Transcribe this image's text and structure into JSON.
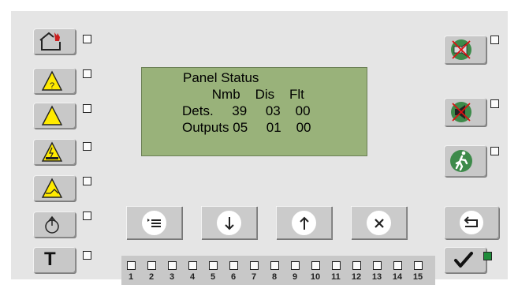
{
  "display": {
    "title": "Panel Status",
    "header_row": "        Nmb    Dis    Flt",
    "dets_row": "Dets.     39     03    00",
    "outputs_row": "Outputs 05     01    00"
  },
  "left_buttons": [
    {
      "icon": "house-fire-icon",
      "led": "off"
    },
    {
      "icon": "warning-question-icon",
      "led": "off"
    },
    {
      "icon": "warning-triangle-icon",
      "led": "off"
    },
    {
      "icon": "electrical-fault-icon",
      "led": "off"
    },
    {
      "icon": "test-triangle-icon",
      "led": "off"
    },
    {
      "icon": "power-icon",
      "led": "off"
    },
    {
      "icon": "test-t-icon",
      "label": "T",
      "led": "off"
    }
  ],
  "right_buttons": [
    {
      "icon": "buzzer-mute-icon",
      "led": "off"
    },
    {
      "icon": "sounder-silence-icon",
      "led": "off"
    },
    {
      "icon": "evacuate-icon",
      "led": "off"
    },
    {
      "icon": "back-icon"
    },
    {
      "icon": "check-icon",
      "led": "on",
      "led_color": "#1e8c3a"
    }
  ],
  "nav_buttons": [
    {
      "icon": "menu-icon"
    },
    {
      "icon": "arrow-down-icon"
    },
    {
      "icon": "arrow-up-icon"
    },
    {
      "icon": "cancel-icon"
    }
  ],
  "zones": [
    "1",
    "2",
    "3",
    "4",
    "5",
    "6",
    "7",
    "8",
    "9",
    "10",
    "11",
    "12",
    "13",
    "14",
    "15"
  ],
  "colors": {
    "lcd": "#99b27a",
    "panel": "#e5e5e5",
    "button": "#c8c8c8",
    "warning": "#ffea00",
    "led_on": "#1e8c3a"
  }
}
